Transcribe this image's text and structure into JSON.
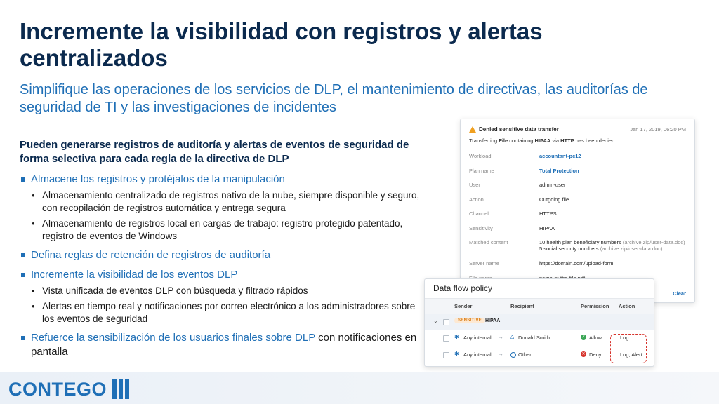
{
  "title": "Incremente la visibilidad con registros y alertas centralizados",
  "subtitle": "Simplifique las operaciones de los servicios de DLP, el mantenimiento de directivas, las auditorías de seguridad de TI y las investigaciones de incidentes",
  "lead": "Pueden generarse registros de auditoría y alertas de eventos de seguridad de forma selectiva para cada regla de la directiva de DLP",
  "bullets": {
    "b1": "Almacene los registros y protéjalos de la manipulación",
    "b1_1": "Almacenamiento centralizado de registros nativo de la nube, siempre disponible y seguro, con recopilación de registros automática y entrega segura",
    "b1_2": "Almacenamiento de registros local en cargas de trabajo: registro protegido patentado, registro de eventos de Windows",
    "b2": "Defina reglas de retención de registros de auditoría",
    "b3": "Incremente la visibilidad de los eventos DLP",
    "b3_1": "Vista unificada de eventos DLP con búsqueda y filtrado rápidos",
    "b3_2": "Alertas en tiempo real y notificaciones por correo electrónico a los administradores sobre los eventos de seguridad",
    "b4_colored": "Refuerce la sensibilización de los usuarios finales sobre DLP",
    "b4_plain": "con notificaciones en pantalla"
  },
  "event_card": {
    "icon": "warning-icon",
    "title": "Denied sensitive data transfer",
    "timestamp": "Jan 17, 2019, 06:20 PM",
    "desc_pre": "Transferring ",
    "desc_file": "File",
    "desc_mid": " containing ",
    "desc_hipaa": "HIPAA",
    "desc_via": " via ",
    "desc_http": "HTTP",
    "desc_post": " has been denied.",
    "rows": [
      {
        "key": "Workload",
        "value": "accountant-pc12"
      },
      {
        "key": "Plan name",
        "value": "Total Protection"
      },
      {
        "key": "User",
        "value": "admin-user"
      },
      {
        "key": "Action",
        "value": "Outgoing file"
      },
      {
        "key": "Channel",
        "value": "HTTPS"
      },
      {
        "key": "Sensitivity",
        "value": "HIPAA"
      },
      {
        "key": "Server name",
        "value": "https://domain.com/upload-form"
      },
      {
        "key": "File name",
        "value": "name-of-the-file.pdf"
      }
    ],
    "matched_key": "Matched content",
    "matched_line1": "10 health plan beneficiary numbers",
    "matched_line1_src": "(archive.zip/user-data.doc)",
    "matched_line2": "5 social security numbers",
    "matched_line2_src": "(archive.zip/user-data.doc)",
    "clear": "Clear"
  },
  "policy_card": {
    "title": "Data flow policy",
    "headers": {
      "sender": "Sender",
      "recipient": "Recipient",
      "permission": "Permission",
      "action": "Action"
    },
    "group_badge": "SENSITIVE",
    "group_name": "HIPAA",
    "rows": [
      {
        "sender": "Any internal",
        "recipient": "Donald Smith",
        "permission": "Allow",
        "action": "Log"
      },
      {
        "sender": "Any internal",
        "recipient": "Other",
        "permission": "Deny",
        "action": "Log, Alert"
      }
    ]
  },
  "logo_text": "CONTEGO"
}
